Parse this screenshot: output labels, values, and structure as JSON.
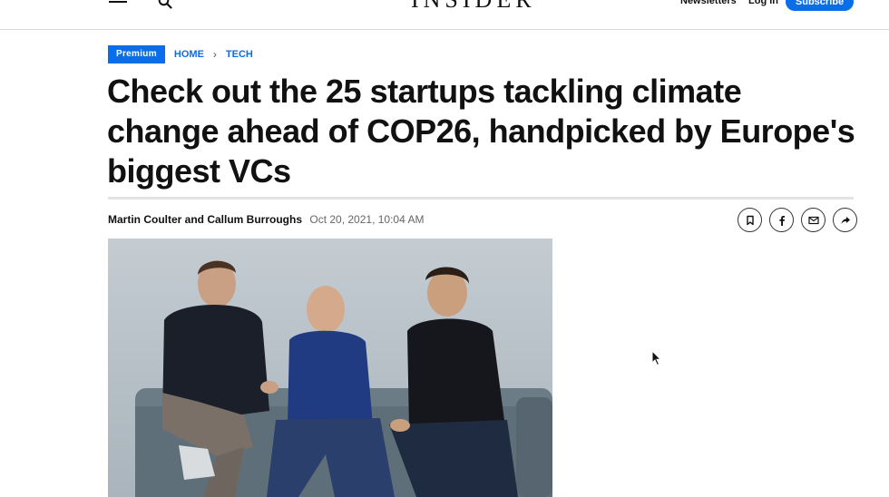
{
  "header": {
    "logo": "INSIDER",
    "nav": {
      "newsletters": "Newsletters",
      "login": "Log in",
      "subscribe": "Subscribe"
    }
  },
  "breadcrumb": {
    "badge": "Premium",
    "items": [
      "HOME",
      "TECH"
    ],
    "separator": "›"
  },
  "article": {
    "headline": "Check out the 25 startups tackling climate change ahead of COP26, handpicked by Europe's biggest VCs",
    "authors": "Martin Coulter and Callum Burroughs",
    "date": "Oct 20, 2021, 10:04 AM"
  },
  "share_buttons": [
    "bookmark-icon",
    "facebook-icon",
    "email-icon",
    "share-icon"
  ],
  "colors": {
    "accent": "#0a6ee8",
    "headline": "#111111",
    "meta": "#666666"
  }
}
